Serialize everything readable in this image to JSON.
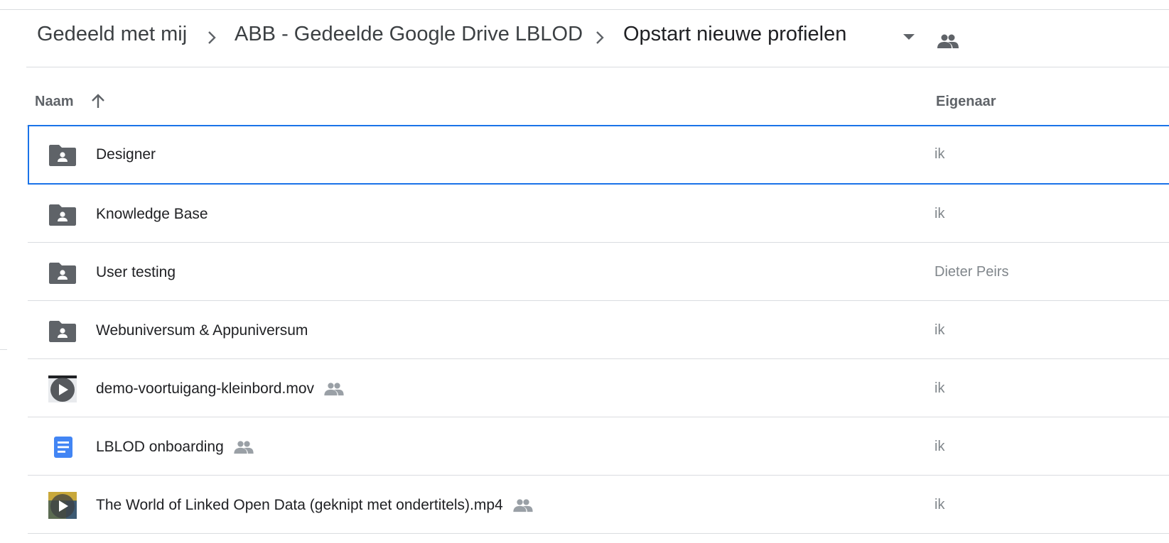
{
  "breadcrumb": {
    "items": [
      {
        "label": "Gedeeld met mij"
      },
      {
        "label": "ABB - Gedeelde Google Drive LBLOD"
      },
      {
        "label": "Opstart nieuwe profielen"
      }
    ],
    "separator_icon": "chevron-right-icon",
    "dropdown_icon": "caret-down-icon",
    "shared_icon": "people-icon"
  },
  "header": {
    "name_label": "Naam",
    "sort_icon": "arrow-up-icon",
    "owner_label": "Eigenaar"
  },
  "files": [
    {
      "name": "Designer",
      "owner": "ik",
      "icon": "shared-folder-icon",
      "shared": false,
      "selected": true
    },
    {
      "name": "Knowledge Base",
      "owner": "ik",
      "icon": "shared-folder-icon",
      "shared": false
    },
    {
      "name": "User testing",
      "owner": "Dieter Peirs",
      "icon": "shared-folder-icon",
      "shared": false
    },
    {
      "name": "Webuniversum & Appuniversum",
      "owner": "ik",
      "icon": "shared-folder-icon",
      "shared": false
    },
    {
      "name": "demo-voortuigang-kleinbord.mov",
      "owner": "ik",
      "icon": "video-thumbnail-icon",
      "shared": true
    },
    {
      "name": "LBLOD onboarding",
      "owner": "ik",
      "icon": "google-docs-icon",
      "shared": true
    },
    {
      "name": "The World of Linked Open Data (geknipt met ondertitels).mp4",
      "owner": "ik",
      "icon": "video-thumbnail-icon",
      "shared": true
    }
  ],
  "colors": {
    "selection": "#1a73e8",
    "folder": "#5f6368",
    "docs": "#4285f4",
    "divider": "#dadce0"
  }
}
